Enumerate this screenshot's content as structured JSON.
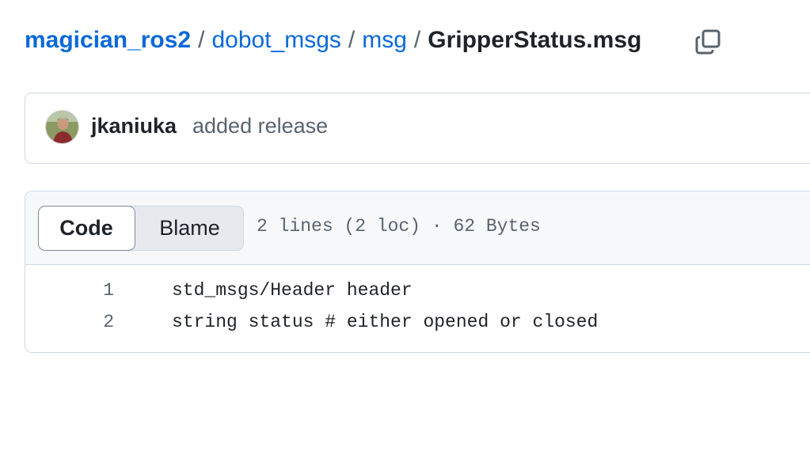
{
  "breadcrumb": {
    "repo": "magician_ros2",
    "sep": "/",
    "dir1": "dobot_msgs",
    "dir2": "msg",
    "file": "GripperStatus.msg"
  },
  "copy_icon": "copy-icon",
  "commit": {
    "author": "jkaniuka",
    "message": "added release"
  },
  "file_header": {
    "tabs": [
      "Code",
      "Blame"
    ],
    "active_tab": "Code",
    "meta": "2 lines (2 loc) · 62 Bytes"
  },
  "code_lines": [
    {
      "num": "1",
      "text": "std_msgs/Header header"
    },
    {
      "num": "2",
      "text": "string status # either opened or closed"
    }
  ],
  "colors": {
    "link": "#0969da",
    "text": "#1f2328",
    "muted": "#59636e",
    "border": "#d1d9e0",
    "header_bg": "#f6f8fa"
  }
}
